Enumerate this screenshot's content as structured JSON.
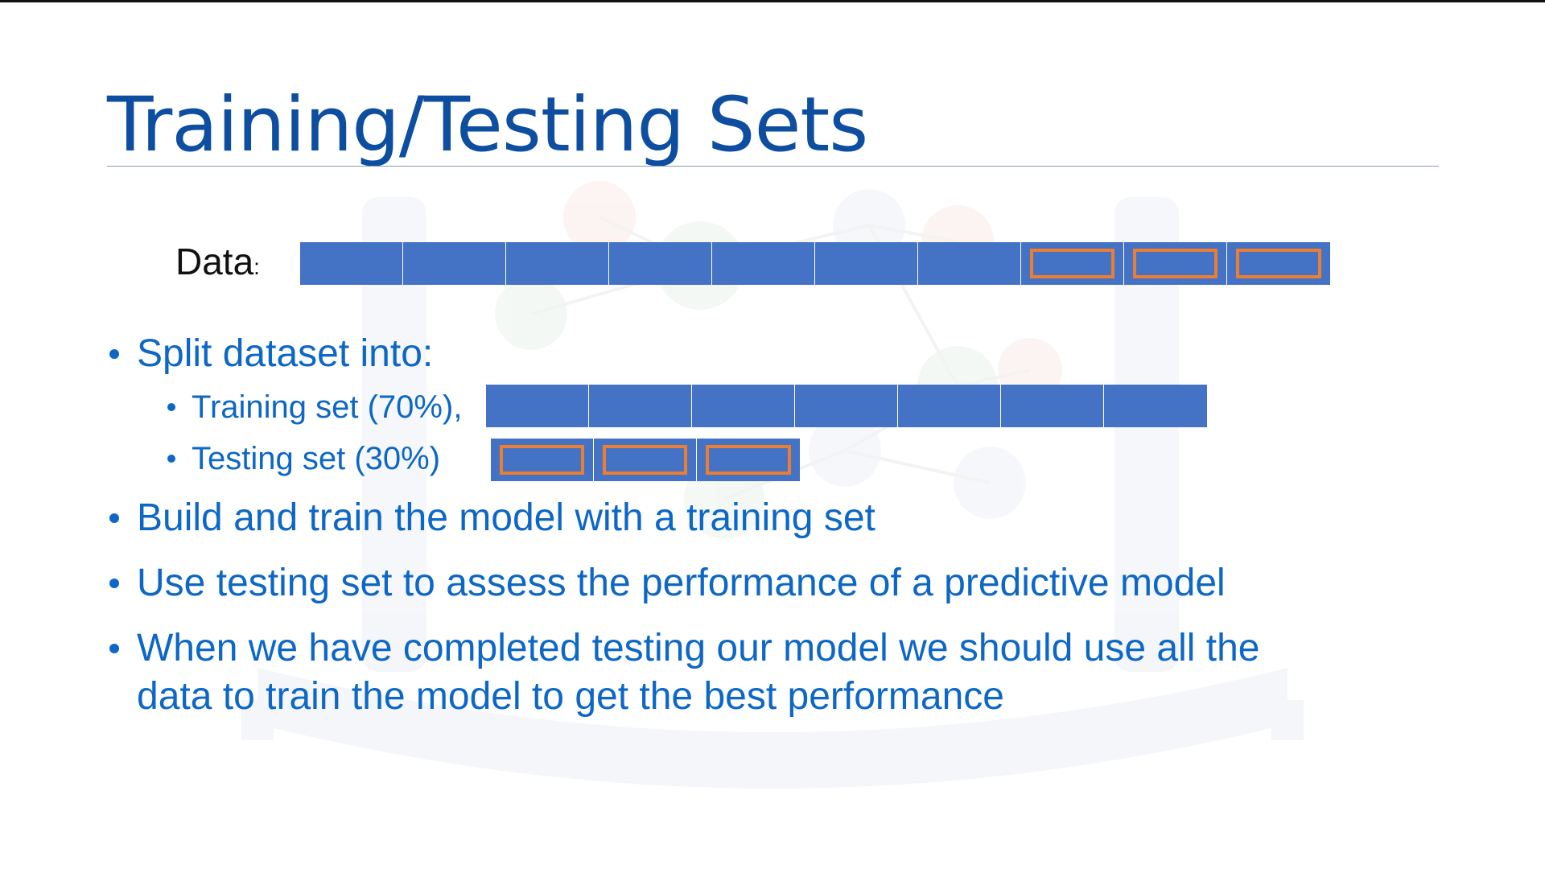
{
  "slide": {
    "title": "Training/Testing Sets",
    "data_label": "Data",
    "data_label_suffix": ":",
    "bullets": [
      "Split dataset into:",
      "Build and train the model with a training set",
      "Use testing set to assess the performance of a predictive model"
    ],
    "sub_bullets": [
      "Training set (70%),",
      "Testing set (30%)"
    ],
    "last_bullet_lines": [
      "When we have completed testing our model we should use all the",
      "data to train the model to get the best performance"
    ]
  },
  "diagram": {
    "data_blocks_total": 10,
    "training_blocks": 7,
    "testing_blocks": 3,
    "training_percent": 70,
    "testing_percent": 30
  },
  "colors": {
    "title": "#0d4ea0",
    "text": "#0d67c6",
    "block_fill": "#4472c4",
    "test_outline": "#ed7d31"
  }
}
